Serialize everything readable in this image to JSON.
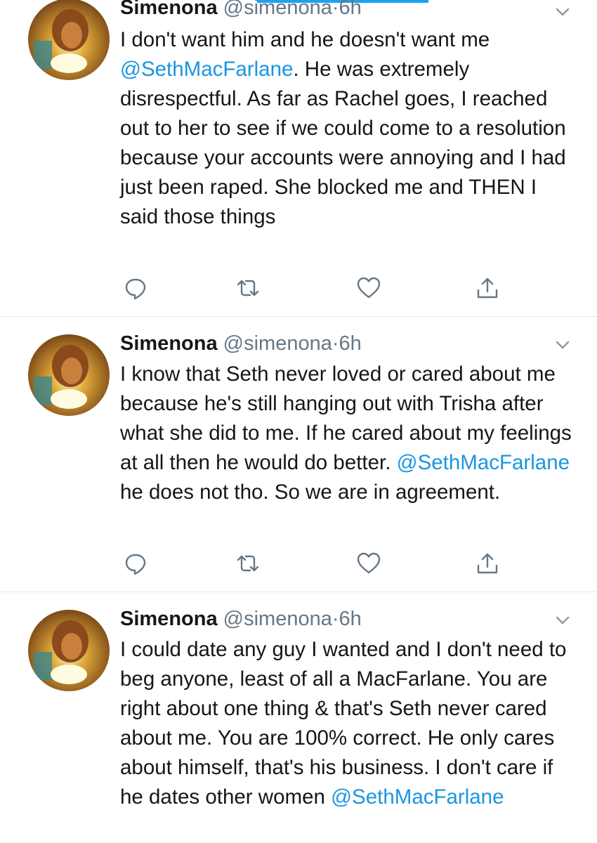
{
  "colors": {
    "link": "#1b95e0",
    "accent": "#1da1f2",
    "muted": "#657786",
    "divider": "#e1e8ed"
  },
  "icons": {
    "reply": "reply-icon",
    "retweet": "retweet-icon",
    "like": "heart-icon",
    "share": "share-icon",
    "more": "chevron-down-icon"
  },
  "tweets": [
    {
      "name": "Simenona",
      "handle": "@simenona",
      "sep": "·",
      "time": "6h",
      "text": [
        {
          "t": "I don't want him and he doesn't want me "
        },
        {
          "t": "@SethMacFarlane",
          "m": true
        },
        {
          "t": ". He was extremely disrespectful.  As far as Rachel goes, I reached out to her to see if we could come to a resolution because your accounts were annoying and I had just been raped.  She blocked me and THEN I said those things"
        }
      ]
    },
    {
      "name": "Simenona",
      "handle": "@simenona",
      "sep": "·",
      "time": "6h",
      "text": [
        {
          "t": "I know that Seth never loved or cared about me because he's still hanging out with Trisha after what she did to me.  If he cared about my feelings at all then he would do better.  "
        },
        {
          "t": "@SethMacFarlane",
          "m": true
        },
        {
          "t": " he does not tho.  So we are in agreement."
        }
      ]
    },
    {
      "name": "Simenona",
      "handle": "@simenona",
      "sep": "·",
      "time": "6h",
      "text": [
        {
          "t": "I could date any guy I wanted and I don't need to beg anyone, least of all a MacFarlane. You are right about one thing & that's Seth never cared about me.  You are 100% correct. He only cares about himself, that's his business. I don't care if he dates other women "
        },
        {
          "t": "@SethMacFarlane",
          "m": true
        }
      ]
    }
  ]
}
